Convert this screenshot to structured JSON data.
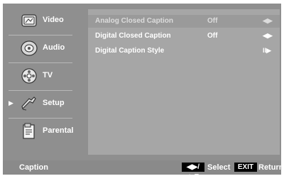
{
  "sidebar": {
    "items": [
      {
        "label": "Video",
        "icon": "video-icon"
      },
      {
        "label": "Audio",
        "icon": "audio-icon"
      },
      {
        "label": "TV",
        "icon": "tv-icon"
      },
      {
        "label": "Setup",
        "icon": "setup-icon",
        "selected": true
      },
      {
        "label": "Parental",
        "icon": "parental-icon"
      }
    ]
  },
  "panel": {
    "rows": [
      {
        "label": "Analog Closed Caption",
        "value": "Off",
        "control": "◀▶",
        "disabled": true
      },
      {
        "label": "Digital Closed Caption",
        "value": "Off",
        "control": "◀▶"
      },
      {
        "label": "Digital Caption Style",
        "value": "",
        "control": "II▶"
      }
    ]
  },
  "bottom": {
    "title": "Caption",
    "nav_keys": "◀▶/▲▼",
    "select_label": "Select",
    "exit_key": "EXIT",
    "return_label": "Return"
  }
}
